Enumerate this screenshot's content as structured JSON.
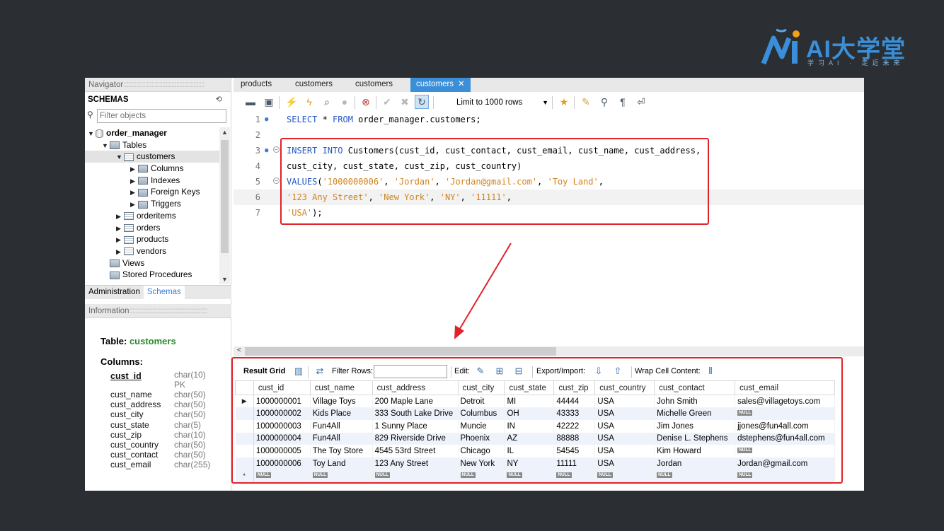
{
  "logo": {
    "brand": "AI大学堂",
    "slogan": "学习AI · 走近未来"
  },
  "navigator": {
    "header": "Navigator",
    "schemas_label": "SCHEMAS",
    "filter_placeholder": "Filter objects",
    "tree": {
      "schema": "order_manager",
      "tables": "Tables",
      "customers": "customers",
      "columns": "Columns",
      "indexes": "Indexes",
      "foreign_keys": "Foreign Keys",
      "triggers": "Triggers",
      "orderitems": "orderitems",
      "orders": "orders",
      "products": "products",
      "vendors": "vendors",
      "views": "Views",
      "stored_procedures": "Stored Procedures"
    },
    "tabs": {
      "administration": "Administration",
      "schemas": "Schemas"
    },
    "info_header": "Information",
    "info": {
      "table_label": "Table:",
      "table_name": "customers",
      "columns_label": "Columns:",
      "pk_label": "PK",
      "columns": [
        {
          "name": "cust_id",
          "type": "char(10)"
        },
        {
          "name": "cust_name",
          "type": "char(50)"
        },
        {
          "name": "cust_address",
          "type": "char(50)"
        },
        {
          "name": "cust_city",
          "type": "char(50)"
        },
        {
          "name": "cust_state",
          "type": "char(5)"
        },
        {
          "name": "cust_zip",
          "type": "char(10)"
        },
        {
          "name": "cust_country",
          "type": "char(50)"
        },
        {
          "name": "cust_contact",
          "type": "char(50)"
        },
        {
          "name": "cust_email",
          "type": "char(255)"
        }
      ]
    }
  },
  "tabs": [
    "products",
    "customers",
    "customers",
    "customers"
  ],
  "toolbar": {
    "limit": "Limit to 1000 rows"
  },
  "editor": {
    "line_numbers": [
      "1",
      "2",
      "3",
      "4",
      "5",
      "6",
      "7"
    ],
    "l1_kw1": "SELECT",
    "l1_mid": " * ",
    "l1_kw2": "FROM",
    "l1_rest": " order_manager.customers;",
    "l3_kw": "INSERT INTO",
    "l3_rest": " Customers(cust_id, cust_contact, cust_email, cust_name, cust_address,",
    "l4": "cust_city, cust_state, cust_zip, cust_country)",
    "l5_kw": "VALUES",
    "l5_p1": "(",
    "l5_s1": "'1000000006'",
    "l5_c1": ", ",
    "l5_s2": "'Jordan'",
    "l5_c2": ", ",
    "l5_s3": "'Jordan@gmail.com'",
    "l5_c3": ", ",
    "l5_s4": "'Toy Land'",
    "l5_c4": ",",
    "l6_s1": "'123 Any Street'",
    "l6_c1": ", ",
    "l6_s2": "'New York'",
    "l6_c2": ", ",
    "l6_s3": "'NY'",
    "l6_c3": ", ",
    "l6_s4": "'11111'",
    "l6_c4": ",",
    "l7_s1": "'USA'",
    "l7_end": ");"
  },
  "result_bar": {
    "result_grid": "Result Grid",
    "filter_rows": "Filter Rows:",
    "edit": "Edit:",
    "export_import": "Export/Import:",
    "wrap": "Wrap Cell Content:"
  },
  "grid": {
    "columns": [
      "cust_id",
      "cust_name",
      "cust_address",
      "cust_city",
      "cust_state",
      "cust_zip",
      "cust_country",
      "cust_contact",
      "cust_email"
    ],
    "rows": [
      [
        "1000000001",
        "Village Toys",
        "200 Maple Lane",
        "Detroit",
        "MI",
        "44444",
        "USA",
        "John Smith",
        "sales@villagetoys.com"
      ],
      [
        "1000000002",
        "Kids Place",
        "333 South Lake Drive",
        "Columbus",
        "OH",
        "43333",
        "USA",
        "Michelle Green",
        "NULL"
      ],
      [
        "1000000003",
        "Fun4All",
        "1 Sunny Place",
        "Muncie",
        "IN",
        "42222",
        "USA",
        "Jim Jones",
        "jjones@fun4all.com"
      ],
      [
        "1000000004",
        "Fun4All",
        "829 Riverside Drive",
        "Phoenix",
        "AZ",
        "88888",
        "USA",
        "Denise L. Stephens",
        "dstephens@fun4all.com"
      ],
      [
        "1000000005",
        "The Toy Store",
        "4545 53rd Street",
        "Chicago",
        "IL",
        "54545",
        "USA",
        "Kim Howard",
        "NULL"
      ],
      [
        "1000000006",
        "Toy Land",
        "123 Any Street",
        "New York",
        "NY",
        "11111",
        "USA",
        "Jordan",
        "Jordan@gmail.com"
      ]
    ],
    "null_label": "NULL",
    "new_row_marker": "*",
    "current_row_marker": "▶"
  },
  "colors": {
    "accent": "#3a8fd8",
    "highlight_box": "#e0232a",
    "keyword": "#2457c4",
    "string": "#d2841e",
    "background": "#2b2f33"
  }
}
